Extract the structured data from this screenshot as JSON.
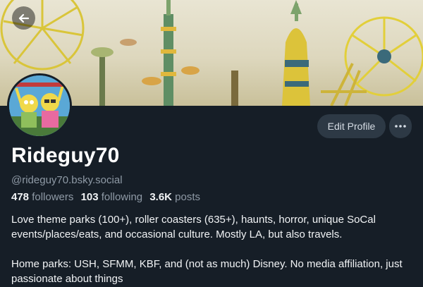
{
  "profile": {
    "display_name": "Rideguy70",
    "handle": "@rideguy70.bsky.social",
    "stats": {
      "followers_count": "478",
      "followers_label": "followers",
      "following_count": "103",
      "following_label": "following",
      "posts_count": "3.6K",
      "posts_label": "posts"
    },
    "bio": [
      "Love theme parks (100+), roller coasters (635+), haunts, horror, unique SoCal events/places/eats, and occasional culture. Mostly LA, but also travels.",
      "Home parks: USH, SFMM, KBF, and (not as much) Disney. No media affiliation, just passionate about things"
    ]
  },
  "actions": {
    "edit_profile_label": "Edit Profile",
    "more_icon": "ellipsis-icon",
    "back_icon": "arrow-left-icon"
  },
  "colors": {
    "background": "#161e27",
    "button_bg": "#2d3945",
    "muted_text": "#8f9aa6"
  }
}
